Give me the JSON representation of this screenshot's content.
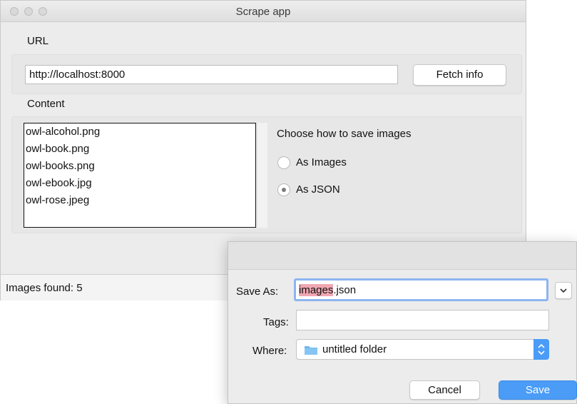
{
  "window": {
    "title": "Scrape app",
    "url_label": "URL",
    "url_value": "http://localhost:8000",
    "fetch_button": "Fetch info",
    "content_label": "Content",
    "files": [
      "owl-alcohol.png",
      "owl-book.png",
      "owl-books.png",
      "owl-ebook.jpg",
      "owl-rose.jpeg"
    ],
    "save_heading": "Choose how to save images",
    "options": [
      {
        "label": "As Images",
        "selected": false
      },
      {
        "label": "As JSON",
        "selected": true
      }
    ],
    "status": "Images found: 5"
  },
  "dialog": {
    "save_as_label": "Save As:",
    "filename_selected": "images",
    "filename_rest": ".json",
    "tags_label": "Tags:",
    "tags_value": "",
    "where_label": "Where:",
    "where_value": "untitled folder",
    "cancel": "Cancel",
    "save": "Save"
  },
  "colors": {
    "save_button": "#4a9cf7",
    "selection_highlight": "#f0a7b2",
    "folder_icon": "#6fb6ee"
  }
}
